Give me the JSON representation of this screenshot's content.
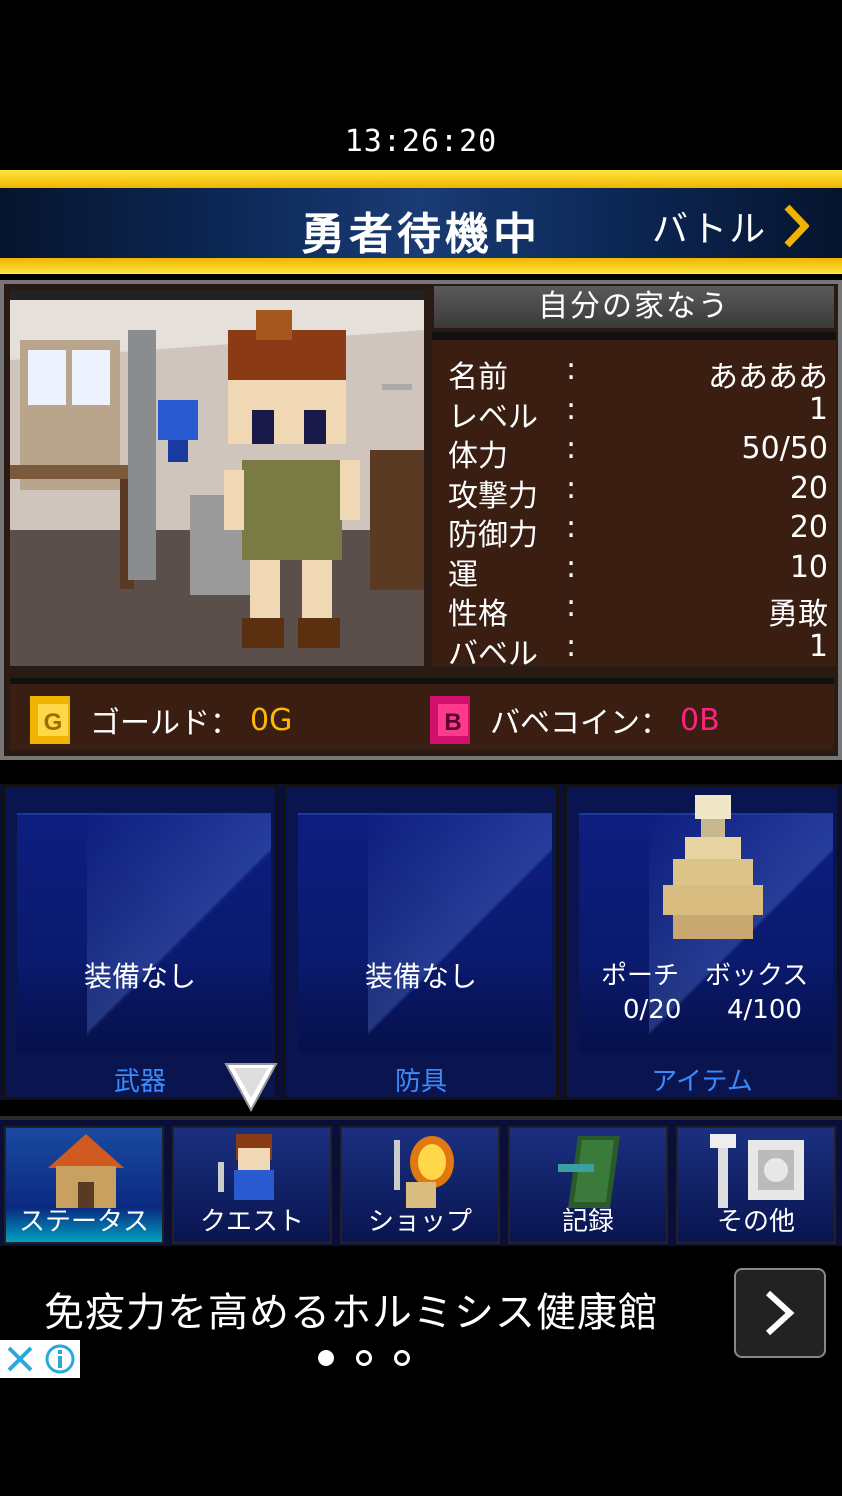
{
  "clock": "13:26:20",
  "header": {
    "title": "勇者待機中",
    "battle_label": "バトル"
  },
  "location": "自分の家なう",
  "stats": [
    {
      "key": "名前",
      "sep": ":",
      "value": "ああああ"
    },
    {
      "key": "レベル",
      "sep": ":",
      "value": "1"
    },
    {
      "key": "体力",
      "sep": ":",
      "value": "50/50"
    },
    {
      "key": "攻撃力",
      "sep": ":",
      "value": "20"
    },
    {
      "key": "防御力",
      "sep": ":",
      "value": "20"
    },
    {
      "key": "運",
      "sep": ":",
      "value": "10"
    },
    {
      "key": "性格",
      "sep": ":",
      "value": "勇敢"
    },
    {
      "key": "バベル",
      "sep": ":",
      "value": "1"
    }
  ],
  "currency": {
    "gold_label": "ゴールド：",
    "gold_value": "0G",
    "coin_label": "バベコイン：",
    "coin_value": "0B"
  },
  "equipment": {
    "weapon": {
      "status": "装備なし",
      "label": "武器"
    },
    "armor": {
      "status": "装備なし",
      "label": "防具"
    },
    "item": {
      "pouch_label": "ポーチ",
      "box_label": "ボックス",
      "pouch_count": "0/20",
      "box_count": "4/100",
      "label": "アイテム"
    }
  },
  "nav": [
    {
      "label": "ステータス",
      "icon": "house-icon",
      "active": true
    },
    {
      "label": "クエスト",
      "icon": "hero-icon",
      "active": false
    },
    {
      "label": "ショップ",
      "icon": "shop-icon",
      "active": false
    },
    {
      "label": "記録",
      "icon": "book-icon",
      "active": false
    },
    {
      "label": "その他",
      "icon": "tools-icon",
      "active": false
    }
  ],
  "ad": {
    "text": "免疫力を高めるホルミシス健康館"
  },
  "colors": {
    "gold": "#ffe640",
    "accent_blue": "#3a8bff",
    "coin_pink": "#ff2080",
    "gold_text": "#ffb800"
  }
}
